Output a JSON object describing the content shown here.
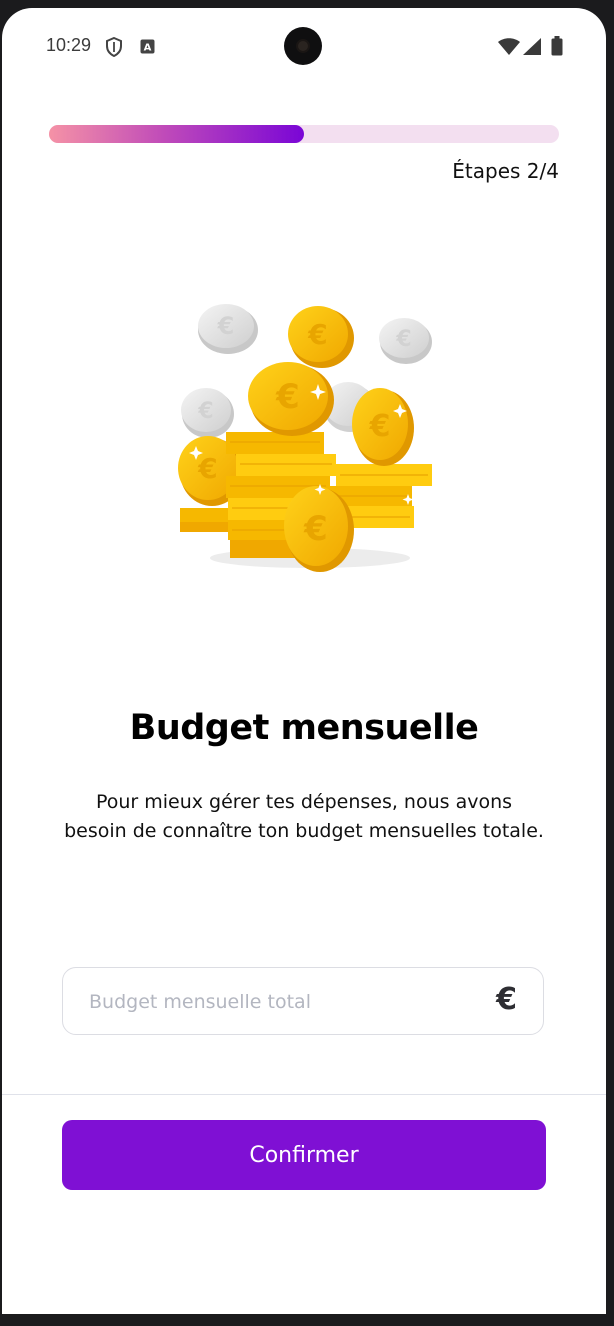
{
  "status_bar": {
    "time": "10:29",
    "icons": [
      "shield-icon",
      "keyboard-a-icon",
      "wifi-icon",
      "signal-icon",
      "battery-icon"
    ]
  },
  "progress": {
    "fraction": 0.5,
    "label": "Étapes 2/4",
    "colors": {
      "start": "#f592a6",
      "end": "#7a06d6",
      "track": "#f3dff0"
    }
  },
  "illustration": {
    "name": "coin-stack-icon"
  },
  "content": {
    "title": "Budget mensuelle",
    "description": "Pour mieux gérer tes dépenses, nous avons besoin de connaître ton budget mensuelles totale."
  },
  "budget_input": {
    "value": "",
    "placeholder": "Budget mensuelle total",
    "currency_symbol": "€"
  },
  "confirm_button": {
    "label": "Confirmer",
    "color": "#7f10d4"
  }
}
